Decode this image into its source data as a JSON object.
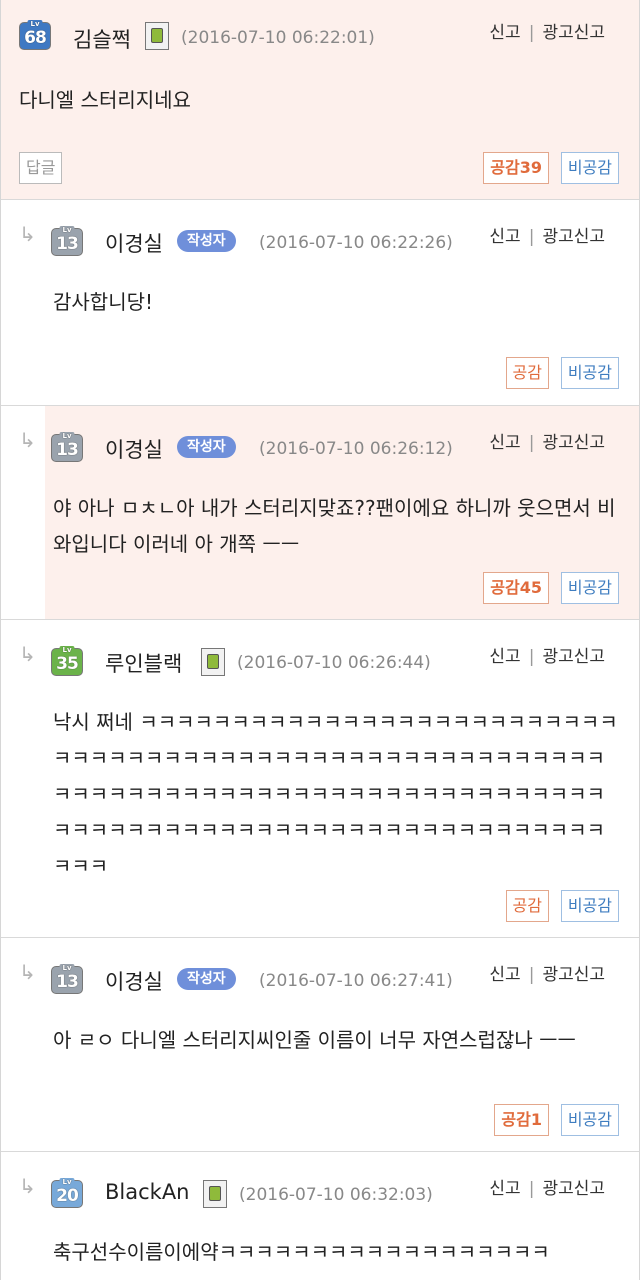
{
  "report_labels": {
    "report": "신고",
    "ad_report": "광고신고"
  },
  "buttons": {
    "reply": "답글",
    "dislike": "비공감"
  },
  "comments": [
    {
      "level": "68",
      "nickname": "김슬쩍",
      "date": "(2016-07-10 06:22:01)",
      "body": "다니엘 스터리지네요",
      "like": "공감39"
    },
    {
      "level": "13",
      "nickname": "이경실",
      "author_badge": "작성자",
      "date": "(2016-07-10 06:22:26)",
      "body": "감사합니당!",
      "like": "공감"
    },
    {
      "level": "13",
      "nickname": "이경실",
      "author_badge": "작성자",
      "date": "(2016-07-10 06:26:12)",
      "body": "야 아나 ㅁㅊㄴ아 내가 스터리지맞죠??팬이에요 하니까 웃으면서 비와입니다 이러네 아 개쪽 ㅡㅡ",
      "like": "공감45"
    },
    {
      "level": "35",
      "nickname": "루인블랙",
      "date": "(2016-07-10 06:26:44)",
      "body": "낙시 쩌네 ㅋㅋㅋㅋㅋㅋㅋㅋㅋㅋㅋㅋㅋㅋㅋㅋㅋㅋㅋㅋㅋㅋㅋㅋㅋㅋㅋㅋㅋㅋㅋㅋㅋㅋㅋㅋㅋㅋㅋㅋㅋㅋㅋㅋㅋㅋㅋㅋㅋㅋㅋㅋㅋㅋㅋㅋㅋㅋㅋㅋㅋㅋㅋㅋㅋㅋㅋㅋㅋㅋㅋㅋㅋㅋㅋㅋㅋㅋㅋㅋㅋㅋㅋㅋㅋㅋㅋㅋㅋㅋㅋㅋㅋㅋㅋㅋㅋㅋㅋㅋㅋㅋㅋㅋㅋㅋㅋㅋㅋㅋㅋㅋㅋㅋㅋㅋㅋㅋㅋ",
      "like": "공감"
    },
    {
      "level": "13",
      "nickname": "이경실",
      "author_badge": "작성자",
      "date": "(2016-07-10 06:27:41)",
      "body": "아 ㄹㅇ 다니엘 스터리지씨인줄 이름이 너무 자연스럽잖나 ㅡㅡ",
      "like": "공감1"
    },
    {
      "level": "20",
      "nickname": "BlackAn",
      "date": "(2016-07-10 06:32:03)",
      "body": "축구선수이름이에약ㅋㅋㅋㅋㅋㅋㅋㅋㅋㅋㅋㅋㅋㅋㅋㅋㅋㅋ"
    }
  ],
  "colors": {
    "highlight_bg": "#fdf0ec",
    "like": "#e06b3c",
    "dislike": "#3f7dc0",
    "author_badge": "#6f8fda"
  }
}
